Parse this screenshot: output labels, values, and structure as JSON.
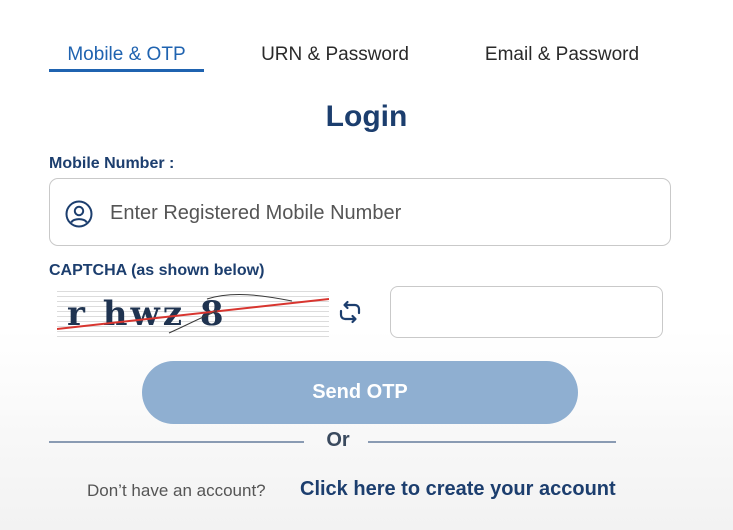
{
  "tabs": [
    {
      "label": "Mobile & OTP",
      "active": true
    },
    {
      "label": "URN & Password",
      "active": false
    },
    {
      "label": "Email & Password",
      "active": false
    }
  ],
  "title": "Login",
  "mobile": {
    "label": "Mobile Number :",
    "placeholder": "Enter Registered Mobile Number",
    "value": ""
  },
  "captcha": {
    "label": "CAPTCHA (as shown below)",
    "image_text": "r hwz 8",
    "input_value": ""
  },
  "send_otp_label": "Send OTP",
  "divider_text": "Or",
  "signup": {
    "prompt": "Don’t have an account?",
    "link": "Click here to create your account"
  },
  "icons": {
    "user": "user-circle-icon",
    "refresh": "refresh-icon"
  },
  "colors": {
    "accent": "#1f63b0",
    "heading": "#1c3e6e",
    "button": "#8fafd1"
  }
}
